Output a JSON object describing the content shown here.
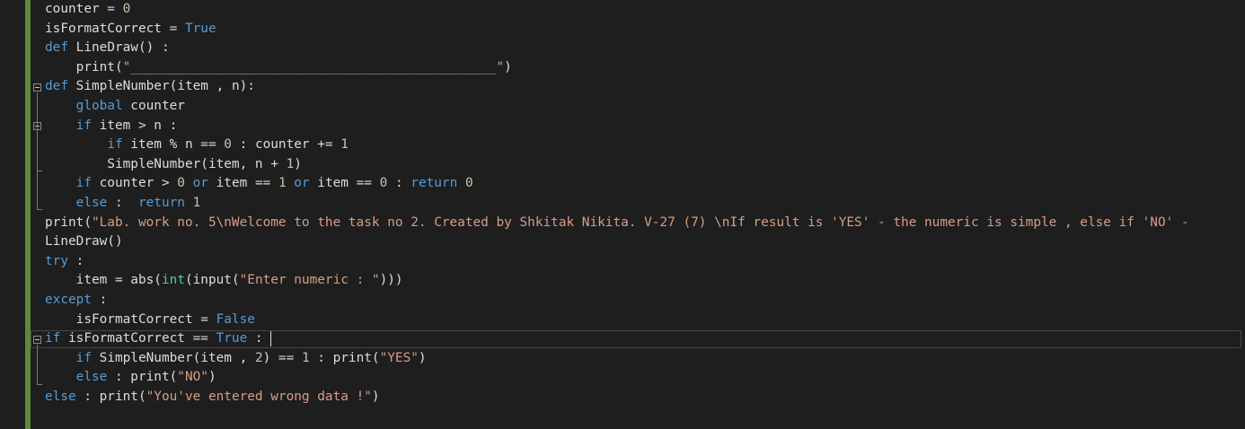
{
  "editor": {
    "lines": [
      [
        {
          "t": "counter = ",
          "c": "id"
        },
        {
          "t": "0",
          "c": "num"
        }
      ],
      [
        {
          "t": "isFormatCorrect = ",
          "c": "id"
        },
        {
          "t": "True",
          "c": "kw"
        }
      ],
      [
        {
          "t": "def",
          "c": "kw"
        },
        {
          "t": " LineDraw() :",
          "c": "id"
        }
      ],
      [
        {
          "t": "    print(",
          "c": "id"
        },
        {
          "t": "\"_______________________________________________\"",
          "c": "str"
        },
        {
          "t": ")",
          "c": "id"
        }
      ],
      [
        {
          "t": "def",
          "c": "kw"
        },
        {
          "t": " SimpleNumber(item , n):",
          "c": "id"
        }
      ],
      [
        {
          "t": "    ",
          "c": "id"
        },
        {
          "t": "global",
          "c": "kw"
        },
        {
          "t": " counter",
          "c": "id"
        }
      ],
      [
        {
          "t": "    ",
          "c": "id"
        },
        {
          "t": "if",
          "c": "kw"
        },
        {
          "t": " item > n :",
          "c": "id"
        }
      ],
      [
        {
          "t": "        ",
          "c": "id"
        },
        {
          "t": "if",
          "c": "kw"
        },
        {
          "t": " item % n == ",
          "c": "id"
        },
        {
          "t": "0",
          "c": "num"
        },
        {
          "t": " : counter += ",
          "c": "id"
        },
        {
          "t": "1",
          "c": "num"
        }
      ],
      [
        {
          "t": "        SimpleNumber(item, n + ",
          "c": "id"
        },
        {
          "t": "1",
          "c": "num"
        },
        {
          "t": ")",
          "c": "id"
        }
      ],
      [
        {
          "t": "    ",
          "c": "id"
        },
        {
          "t": "if",
          "c": "kw"
        },
        {
          "t": " counter > ",
          "c": "id"
        },
        {
          "t": "0",
          "c": "num"
        },
        {
          "t": " ",
          "c": "id"
        },
        {
          "t": "or",
          "c": "kw"
        },
        {
          "t": " item == ",
          "c": "id"
        },
        {
          "t": "1",
          "c": "num"
        },
        {
          "t": " ",
          "c": "id"
        },
        {
          "t": "or",
          "c": "kw"
        },
        {
          "t": " item == ",
          "c": "id"
        },
        {
          "t": "0",
          "c": "num"
        },
        {
          "t": " : ",
          "c": "id"
        },
        {
          "t": "return",
          "c": "kw"
        },
        {
          "t": " ",
          "c": "id"
        },
        {
          "t": "0",
          "c": "num"
        }
      ],
      [
        {
          "t": "    ",
          "c": "id"
        },
        {
          "t": "else",
          "c": "kw"
        },
        {
          "t": " :  ",
          "c": "id"
        },
        {
          "t": "return",
          "c": "kw"
        },
        {
          "t": " ",
          "c": "id"
        },
        {
          "t": "1",
          "c": "num"
        }
      ],
      [
        {
          "t": "print(",
          "c": "id"
        },
        {
          "t": "\"Lab. work no. 5\\nWelcome to the task no 2. Created by Shkitak Nikita. V-27 (7) \\nIf result is 'YES' - the numeric is simple , else if 'NO' - ",
          "c": "str"
        }
      ],
      [
        {
          "t": "LineDraw()",
          "c": "id"
        }
      ],
      [
        {
          "t": "try",
          "c": "kw"
        },
        {
          "t": " :",
          "c": "id"
        }
      ],
      [
        {
          "t": "    item = abs(",
          "c": "id"
        },
        {
          "t": "int",
          "c": "bi"
        },
        {
          "t": "(input(",
          "c": "id"
        },
        {
          "t": "\"Enter numeric : \"",
          "c": "str"
        },
        {
          "t": ")))",
          "c": "id"
        }
      ],
      [
        {
          "t": "except",
          "c": "kw"
        },
        {
          "t": " :",
          "c": "id"
        }
      ],
      [
        {
          "t": "    isFormatCorrect = ",
          "c": "id"
        },
        {
          "t": "False",
          "c": "kw"
        }
      ],
      [
        {
          "t": "if",
          "c": "kw"
        },
        {
          "t": " isFormatCorrect == ",
          "c": "id"
        },
        {
          "t": "True",
          "c": "kw"
        },
        {
          "t": " : ",
          "c": "id"
        }
      ],
      [
        {
          "t": "    ",
          "c": "id"
        },
        {
          "t": "if",
          "c": "kw"
        },
        {
          "t": " SimpleNumber(item , ",
          "c": "id"
        },
        {
          "t": "2",
          "c": "num"
        },
        {
          "t": ") == ",
          "c": "id"
        },
        {
          "t": "1",
          "c": "num"
        },
        {
          "t": " : print(",
          "c": "id"
        },
        {
          "t": "\"YES\"",
          "c": "str"
        },
        {
          "t": ")",
          "c": "id"
        }
      ],
      [
        {
          "t": "    ",
          "c": "id"
        },
        {
          "t": "else",
          "c": "kw"
        },
        {
          "t": " : print(",
          "c": "id"
        },
        {
          "t": "\"NO\"",
          "c": "str"
        },
        {
          "t": ")",
          "c": "id"
        }
      ],
      [
        {
          "t": "else",
          "c": "kw"
        },
        {
          "t": " : print(",
          "c": "id"
        },
        {
          "t": "\"You've entered wrong data !\"",
          "c": "str"
        },
        {
          "t": ")",
          "c": "id"
        }
      ]
    ],
    "current_line_index": 17,
    "colors": {
      "background": "#1e1e1e",
      "keyword": "#569cd6",
      "string": "#d69d85",
      "number": "#b5cea8",
      "identifier": "#dcdcdc",
      "builtin": "#4ec9b0",
      "change_bar": "#5c8a3a"
    },
    "icons": {
      "fold": "collapse-minus-icon"
    }
  }
}
